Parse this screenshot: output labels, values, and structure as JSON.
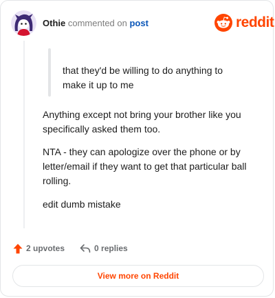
{
  "header": {
    "author": "Othie",
    "action_text": "commented on",
    "link_text": "post"
  },
  "brand": {
    "wordmark": "reddit",
    "color": "#ff4500"
  },
  "comment": {
    "quote": "that they'd be willing to do anything to make it up to me",
    "paragraphs": [
      "Anything except not bring your brother like you specifically asked them too.",
      "NTA - they can apologize over the phone or by letter/email if they want to get that particular ball rolling.",
      "edit dumb mistake"
    ]
  },
  "actions": {
    "upvotes_label": "2 upvotes",
    "replies_label": "0 replies",
    "upvote_icon": "upvote-arrow-icon",
    "reply_icon": "reply-arrow-icon",
    "upvote_color": "#ff4500"
  },
  "cta": {
    "label": "View more on Reddit"
  }
}
